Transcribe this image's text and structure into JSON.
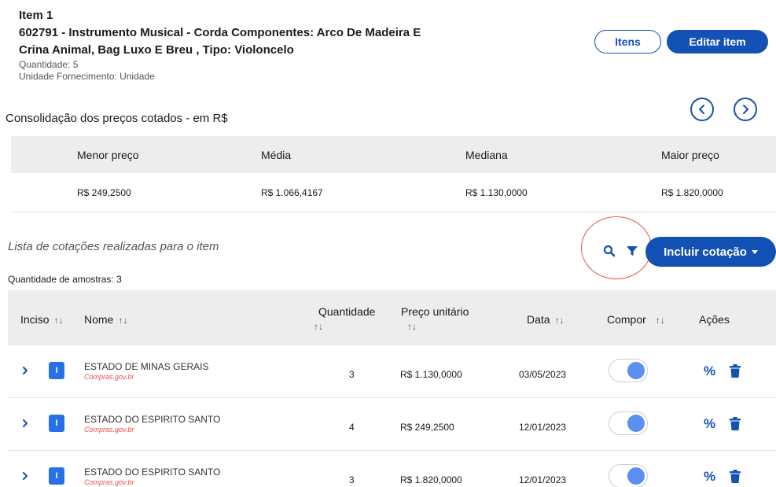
{
  "item": {
    "title": "Item 1",
    "description": "602791 - Instrumento Musical - Corda Componentes: Arco De Madeira E Crina Animal, Bag Luxo E Breu , Tipo: Violoncelo",
    "quantity": "Quantidade: 5",
    "unit": "Unidade Fornecimento: Unidade"
  },
  "actions": {
    "itens_label": "Itens",
    "editar_label": "Editar item",
    "incluir_label": "Incluir cotação"
  },
  "summary": {
    "title": "Consolidação dos preços cotados - em R$",
    "headers": [
      "Menor preço",
      "Média",
      "Mediana",
      "Maior preço"
    ],
    "values": [
      "R$ 249,2500",
      "R$ 1.066,4167",
      "R$ 1.130,0000",
      "R$ 1.820,0000"
    ]
  },
  "list": {
    "caption": "Lista de cotações realizadas para o item",
    "sample_count": "Quantidade de amostras: 3",
    "headers": {
      "inciso": "Inciso",
      "nome": "Nome",
      "quantidade": "Quantidade",
      "preco": "Preço unitário",
      "data": "Data",
      "compor": "Compor",
      "acoes": "Ações"
    },
    "sort_glyph": "↑↓",
    "rows": [
      {
        "inciso": "I",
        "nome": "ESTADO DE MINAS GERAIS",
        "fonte": "Compras.gov.br",
        "quantidade": "3",
        "preco": "R$ 1.130,0000",
        "data": "03/05/2023",
        "compor": true
      },
      {
        "inciso": "I",
        "nome": "ESTADO DO ESPIRITO SANTO",
        "fonte": "Compras.gov.br",
        "quantidade": "4",
        "preco": "R$ 249,2500",
        "data": "12/01/2023",
        "compor": true
      },
      {
        "inciso": "I",
        "nome": "ESTADO DO ESPIRITO SANTO",
        "fonte": "Compras.gov.br",
        "quantidade": "3",
        "preco": "R$ 1.820,0000",
        "data": "12/01/2023",
        "compor": true
      }
    ],
    "row_action_percent": "%"
  },
  "colors": {
    "primary": "#1351b4",
    "badge": "#2670e8",
    "toggle": "#5b8ff0",
    "source": "#e54f4f",
    "header_bg": "#ededed"
  },
  "icons": [
    "chevron-left-icon",
    "chevron-right-icon",
    "search-icon",
    "filter-icon",
    "chevron-right-icon",
    "trash-icon",
    "caret-down-icon"
  ]
}
